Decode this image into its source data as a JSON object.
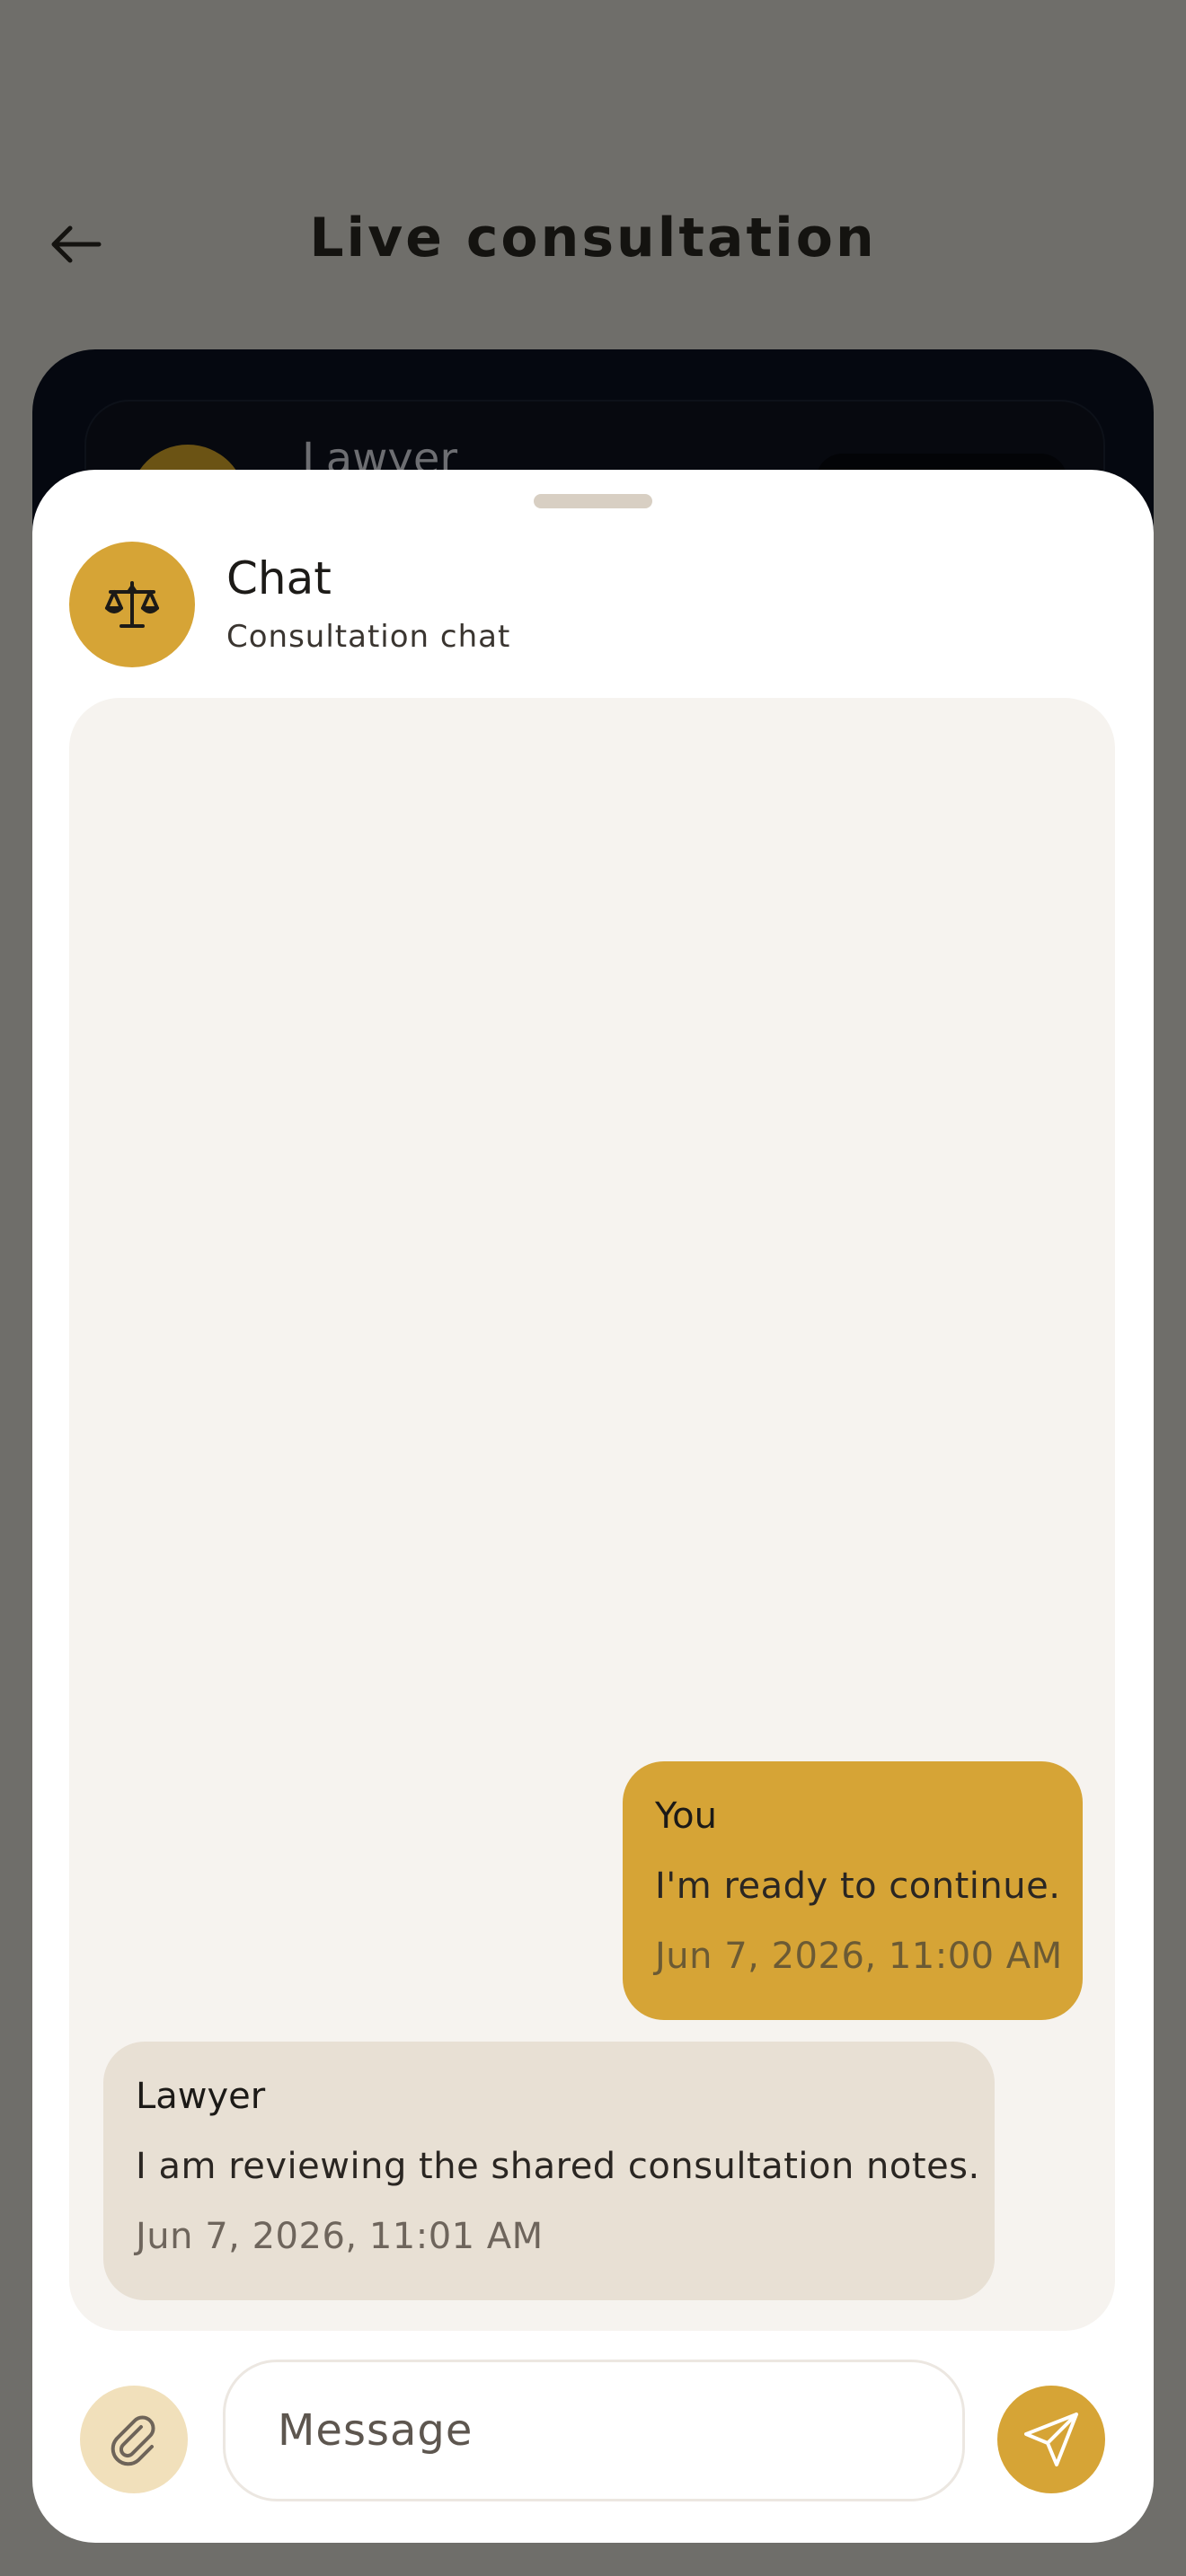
{
  "header": {
    "title": "Live consultation",
    "back_icon": "arrow-left-icon"
  },
  "background_card": {
    "name": "Lawyer"
  },
  "sheet": {
    "title": "Chat",
    "subtitle": "Consultation chat",
    "avatar_icon": "scales-of-justice-icon",
    "accent_color": "#d6a436"
  },
  "messages": [
    {
      "sender": "You",
      "text": "I'm ready to continue.",
      "time": "Jun 7, 2026, 11:00 AM",
      "own": true
    },
    {
      "sender": "Lawyer",
      "text": "I am reviewing the shared consultation notes.",
      "time": "Jun 7, 2026, 11:01 AM",
      "own": false
    }
  ],
  "composer": {
    "placeholder": "Message",
    "attach_icon": "paperclip-icon",
    "send_icon": "send-icon"
  }
}
